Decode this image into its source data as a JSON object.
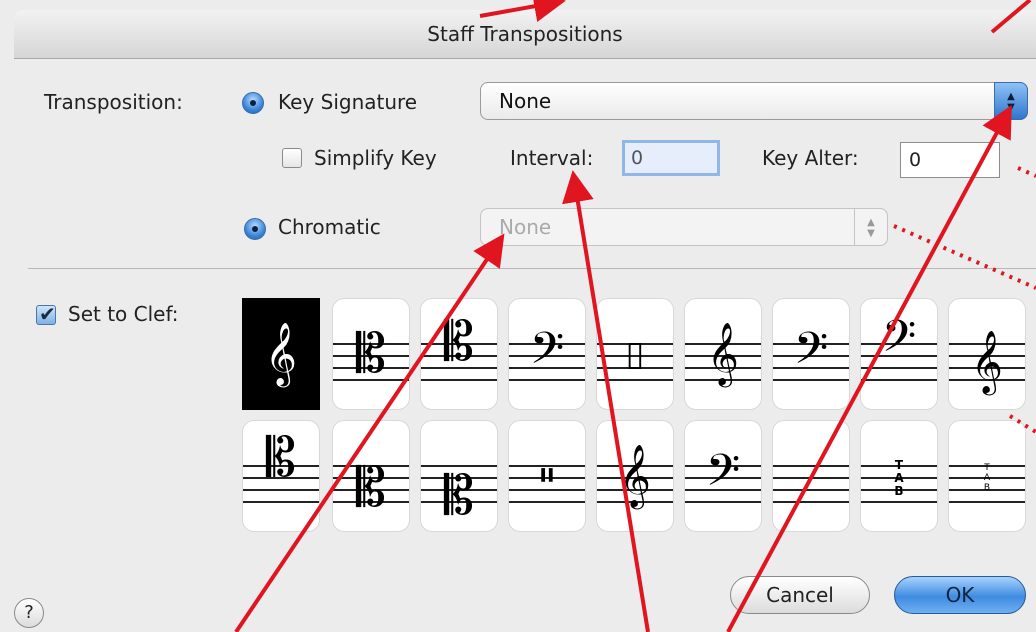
{
  "dialog": {
    "title": "Staff Transpositions",
    "transposition_label": "Transposition:",
    "key_signature_label": "Key Signature",
    "key_signature_value": "None",
    "simplify_key_label": "Simplify Key",
    "simplify_key_checked": false,
    "interval_label": "Interval:",
    "interval_value": "0",
    "key_alter_label": "Key Alter:",
    "key_alter_value": "0",
    "chromatic_label": "Chromatic",
    "chromatic_value": "None",
    "set_to_clef_label": "Set to Clef:",
    "set_to_clef_checked": true,
    "cancel_label": "Cancel",
    "ok_label": "OK",
    "help_label": "?"
  },
  "clefs": {
    "row1": [
      "treble",
      "alto",
      "tenor",
      "bass",
      "percussion",
      "treble-8vb",
      "bass-8vb",
      "baritone-f",
      "french-violin"
    ],
    "row2": [
      "soprano",
      "mezzo-soprano",
      "baritone-c",
      "percussion-2",
      "treble-8va",
      "bass-8va",
      "blank",
      "tab",
      "tab-small"
    ],
    "selected": "treble"
  },
  "glyphs": {
    "treble": "𝄞",
    "c-clef": "𝄡",
    "bass": "𝄢",
    "percussion": "▯",
    "percussion-2": "𝄥",
    "tab": "T\nA\nB"
  },
  "colors": {
    "accent": "#3f8be0",
    "annotation": "#e0151f",
    "window": "#ececec"
  }
}
